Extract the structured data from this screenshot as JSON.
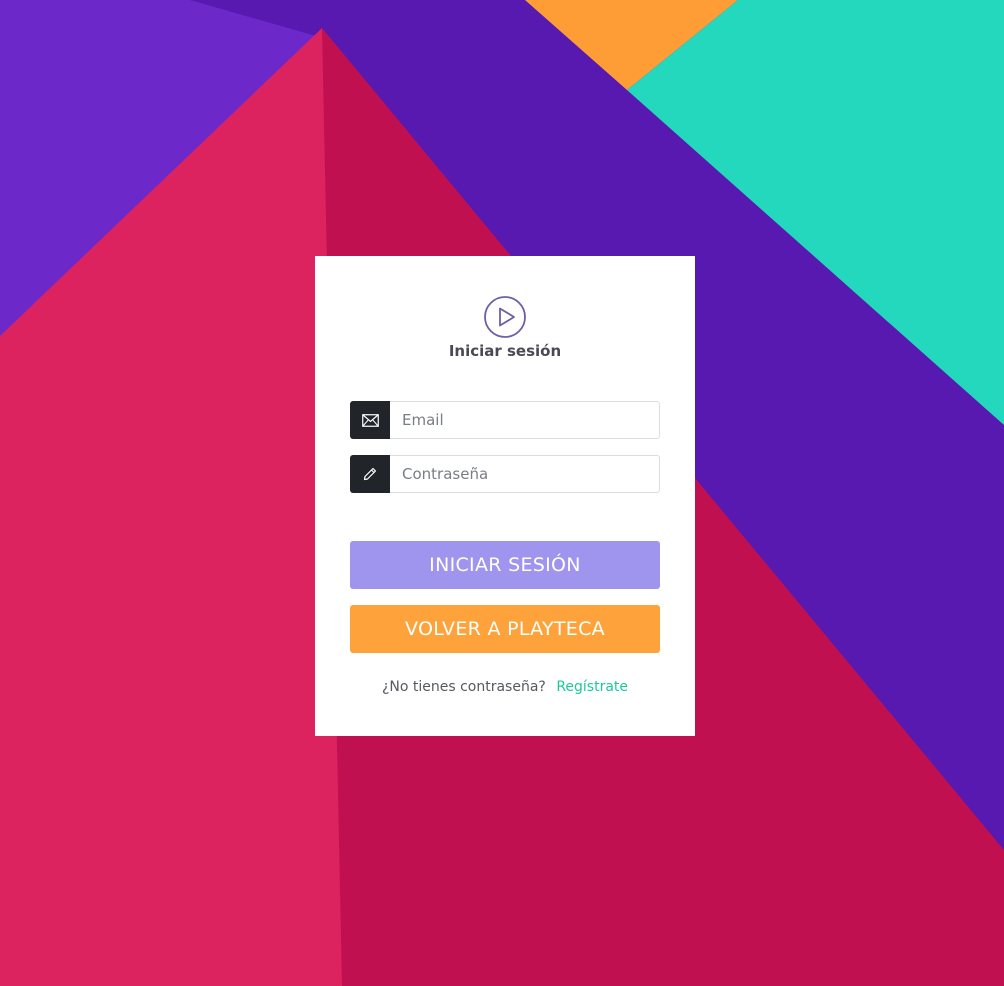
{
  "colors": {
    "card_background": "#ffffff",
    "login_button": "#9f95ef",
    "back_button": "#fea33b",
    "register_link": "#1dc99c",
    "input_addon": "#212529",
    "logo_stroke": "#6b5fa8"
  },
  "login": {
    "logo_icon": "play-circle-icon",
    "title": "Iniciar sesión",
    "email": {
      "icon": "envelope-icon",
      "placeholder": "Email",
      "value": ""
    },
    "password": {
      "icon": "pencil-icon",
      "placeholder": "Contraseña",
      "value": ""
    },
    "submit_label": "INICIAR SESIÓN",
    "back_label": "VOLVER A PLAYTECA",
    "footer": {
      "text": "¿No tienes contraseña?",
      "link_label": "Regístrate"
    }
  }
}
